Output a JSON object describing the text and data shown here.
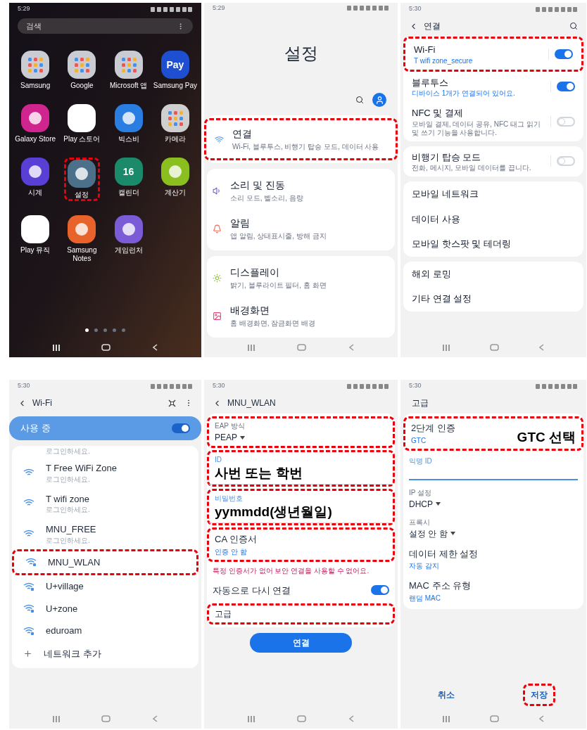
{
  "screens": [
    {
      "kind": "home",
      "time": "5:29",
      "search": {
        "placeholder": "검색"
      },
      "apps": [
        {
          "kind": "folder",
          "label": "Samsung",
          "color": "#c9ccd3",
          "highlighted": false
        },
        {
          "kind": "folder",
          "label": "Google",
          "color": "#c9ccd3",
          "highlighted": false
        },
        {
          "kind": "folder",
          "label": "Microsoft 앱",
          "color": "#c9ccd3",
          "highlighted": false
        },
        {
          "kind": "app",
          "label": "Samsung Pay",
          "color": "#1f4fd1",
          "glyph": "Pay",
          "highlighted": false
        },
        {
          "kind": "app",
          "label": "Galaxy Store",
          "color": "#d0258f",
          "highlighted": false
        },
        {
          "kind": "app",
          "label": "Play 스토어",
          "color": "#ffffff",
          "highlighted": false
        },
        {
          "kind": "app",
          "label": "빅스비",
          "color": "#2a7de1",
          "highlighted": false
        },
        {
          "kind": "folder",
          "label": "카메라",
          "color": "#cfcfcf",
          "highlighted": false
        },
        {
          "kind": "app",
          "label": "시계",
          "color": "#5a3fd6",
          "highlighted": false
        },
        {
          "kind": "app",
          "label": "설정",
          "color": "#4c6f8a",
          "highlighted": true
        },
        {
          "kind": "app",
          "label": "캘린더",
          "color": "#1a8a6a",
          "glyph": "16",
          "highlighted": false
        },
        {
          "kind": "app",
          "label": "계산기",
          "color": "#8bbf1f",
          "highlighted": false
        },
        {
          "kind": "app",
          "label": "Play 뮤직",
          "color": "#ffffff",
          "highlighted": false
        },
        {
          "kind": "app",
          "label": "Samsung Notes",
          "color": "#e8632b",
          "highlighted": false
        },
        {
          "kind": "app",
          "label": "게임런처",
          "color": "#7b5cd6",
          "highlighted": false
        }
      ],
      "pages": [
        {
          "selected": true
        },
        {
          "selected": false
        },
        {
          "selected": false
        },
        {
          "selected": false
        },
        {
          "selected": false
        }
      ]
    },
    {
      "kind": "settings_home",
      "time": "5:29",
      "title": "설정",
      "groups": [
        {
          "items": [
            {
              "title": "연결",
              "subtitle": "Wi-Fi, 블루투스, 비행기 탑승 모드, 데이터 사용",
              "highlighted": true
            }
          ]
        },
        {
          "items": [
            {
              "title": "소리 및 진동",
              "subtitle": "소리 모드, 벨소리, 음량",
              "highlighted": false
            },
            {
              "title": "알림",
              "subtitle": "앱 알림, 상태표시줄, 방해 금지",
              "highlighted": false
            }
          ]
        },
        {
          "items": [
            {
              "title": "디스플레이",
              "subtitle": "밝기, 블루라이트 필터, 홈 화면",
              "highlighted": false
            },
            {
              "title": "배경화면",
              "subtitle": "홈 배경화면, 잠금화면 배경",
              "highlighted": false
            }
          ]
        }
      ]
    },
    {
      "kind": "connections",
      "time": "5:30",
      "title": "연결",
      "groups": [
        {
          "rows": [
            {
              "title": "Wi-Fi",
              "subtitle": "T wifi zone_secure",
              "on": true,
              "highlighted": true
            },
            {
              "title": "블루투스",
              "subtitle": "디바이스 1개가 연결되어 있어요.",
              "on": true,
              "highlighted": false
            },
            {
              "title": "NFC 및 결제",
              "subtitle": "모바일 결제, 데이터 공유, NFC 태그 읽기 및 쓰기 기능을 사용합니다.",
              "on": false,
              "highlighted": false
            }
          ]
        },
        {
          "rows": [
            {
              "title": "비행기 탑승 모드",
              "subtitle": "전화, 메시지, 모바일 데이터를 끕니다.",
              "on": false,
              "highlighted": false
            }
          ]
        },
        {
          "rows": [
            {
              "title": "모바일 네트워크",
              "highlighted": false
            },
            {
              "title": "데이터 사용",
              "highlighted": false
            },
            {
              "title": "모바일 핫스팟 및 테더링",
              "highlighted": false
            }
          ]
        },
        {
          "rows": [
            {
              "title": "해외 로밍",
              "highlighted": false
            },
            {
              "title": "기타 연결 설정",
              "highlighted": false
            }
          ]
        }
      ]
    },
    {
      "kind": "wifi_list",
      "time": "5:30",
      "title": "Wi-Fi",
      "master": {
        "label": "사용 중",
        "on": true
      },
      "networks": [
        {
          "subtitle": "로그인하세요.",
          "highlighted": false
        },
        {
          "name": "T Free WiFi Zone",
          "subtitle": "로그인하세요.",
          "secured": false,
          "highlighted": false
        },
        {
          "name": "T wifi zone",
          "subtitle": "로그인하세요.",
          "secured": false,
          "highlighted": false
        },
        {
          "name": "MNU_FREE",
          "subtitle": "로그인하세요.",
          "secured": false,
          "highlighted": false
        },
        {
          "name": "MNU_WLAN",
          "secured": true,
          "highlighted": true
        },
        {
          "name": "U+village",
          "secured": true,
          "highlighted": false
        },
        {
          "name": "U+zone",
          "secured": true,
          "highlighted": false
        },
        {
          "name": "eduroam",
          "secured": true,
          "highlighted": false
        }
      ],
      "add_label": "네트워크 추가"
    },
    {
      "kind": "form",
      "time": "5:30",
      "title": "MNU_WLAN",
      "fields": [
        {
          "kind": "dropdown",
          "label": "EAP 방식",
          "value": "PEAP",
          "highlighted": true
        },
        {
          "kind": "text",
          "label": "ID",
          "annotation": "사번 또는 학번",
          "highlighted": true
        },
        {
          "kind": "text",
          "label": "비밀번호",
          "annotation": "yymmdd(생년월일)",
          "highlighted": true
        },
        {
          "kind": "option",
          "label": "CA 인증서",
          "value": "인증 안 함",
          "highlighted": true
        },
        {
          "kind": "warning",
          "text": "특정 인증서가 없어 보안 연결을 사용할 수 없어요.",
          "highlighted": false
        },
        {
          "kind": "switch",
          "label": "자동으로 다시 연결",
          "on": true,
          "highlighted": false
        },
        {
          "kind": "link",
          "label": "고급",
          "highlighted": true
        }
      ],
      "buttons": [
        {
          "label": "연결",
          "highlighted": false
        }
      ]
    },
    {
      "kind": "form",
      "time": "5:30",
      "title": "고급",
      "fields": [
        {
          "kind": "option",
          "label": "2단계 인증",
          "value": "GTC",
          "annotation": "GTC 선택",
          "highlighted": true
        },
        {
          "kind": "input",
          "label": "익명 ID",
          "highlighted": false
        },
        {
          "kind": "dropdown",
          "label": "IP 설정",
          "value": "DHCP",
          "highlighted": false
        },
        {
          "kind": "dropdown",
          "label": "프록시",
          "value": "설정 안 함",
          "highlighted": false
        },
        {
          "kind": "option",
          "label": "데이터 제한 설정",
          "value": "자동 감지",
          "highlighted": false
        },
        {
          "kind": "option",
          "label": "MAC 주소 유형",
          "value": "랜덤 MAC",
          "highlighted": false
        }
      ],
      "buttons": [
        {
          "label": "취소",
          "highlighted": false
        },
        {
          "label": "저장",
          "highlighted": true
        }
      ]
    }
  ]
}
